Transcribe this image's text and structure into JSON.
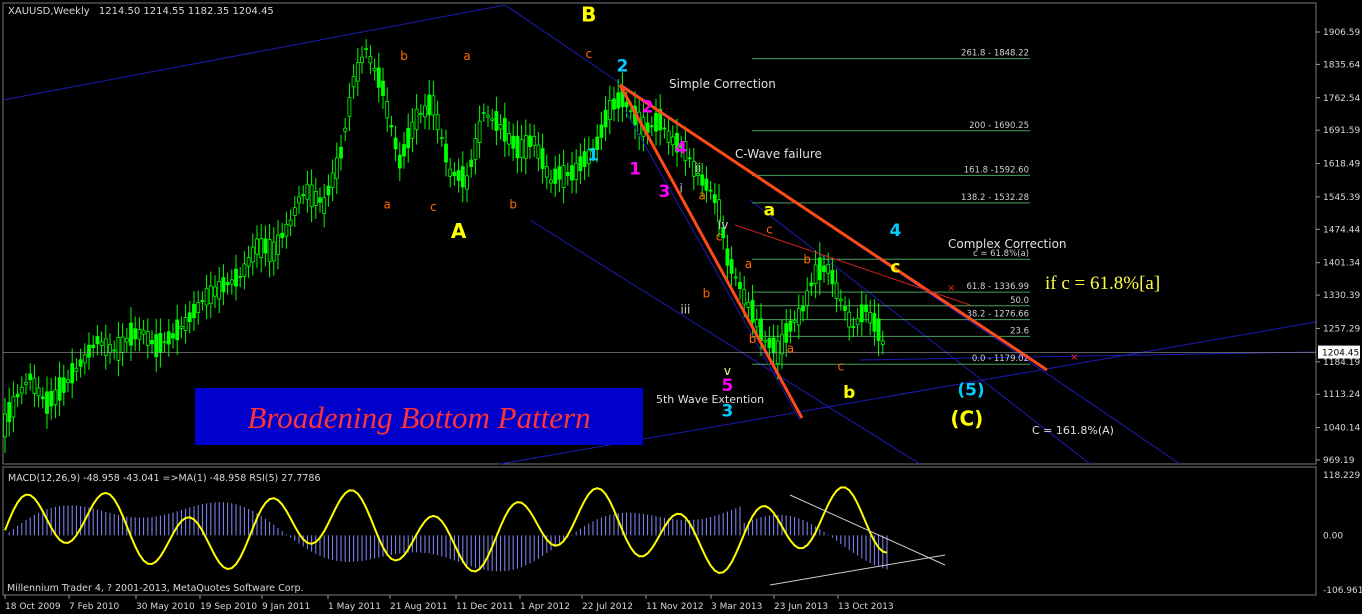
{
  "header": {
    "symbol": "XAUUSD,Weekly",
    "ohlc": "1214.50 1214.55 1182.35 1204.45"
  },
  "chart_data": {
    "type": "line",
    "price_axis": {
      "ticks": [
        1906.59,
        1835.64,
        1762.54,
        1691.59,
        1618.49,
        1545.39,
        1474.44,
        1401.34,
        1330.39,
        1257.29,
        1184.19,
        1113.24,
        1040.14,
        969.19
      ],
      "ylim": [
        969.19,
        1940
      ],
      "current_price": 1204.45
    },
    "time_axis": {
      "ticks": [
        "18 Oct 2009",
        "7 Feb 2010",
        "30 May 2010",
        "19 Sep 2010",
        "9 Jan 2011",
        "1 May 2011",
        "21 Aug 2011",
        "11 Dec 2011",
        "1 Apr 2012",
        "22 Jul 2012",
        "11 Nov 2012",
        "3 Mar 2013",
        "23 Jun 2013",
        "13 Oct 2013"
      ]
    },
    "price_series": {
      "name": "XAUUSD Weekly close (approx.)",
      "t": [
        0,
        3,
        6,
        10,
        14,
        18,
        22,
        26,
        30,
        33,
        36,
        40,
        44,
        48,
        52,
        56,
        60,
        64,
        68,
        70,
        72,
        76,
        80,
        83,
        86,
        90,
        94,
        98,
        102,
        106,
        110,
        114,
        118,
        122,
        126,
        130,
        132,
        135,
        138,
        141,
        144,
        147,
        150,
        153,
        156,
        158,
        160,
        162,
        164,
        166,
        168,
        170,
        172,
        175,
        178,
        181,
        184,
        187,
        190,
        193,
        196,
        199,
        202,
        205,
        208,
        210
      ],
      "close": [
        1050,
        1110,
        1150,
        1090,
        1130,
        1180,
        1230,
        1210,
        1240,
        1250,
        1215,
        1240,
        1280,
        1330,
        1350,
        1370,
        1440,
        1430,
        1490,
        1540,
        1560,
        1530,
        1640,
        1800,
        1870,
        1780,
        1620,
        1720,
        1750,
        1600,
        1580,
        1730,
        1700,
        1650,
        1670,
        1580,
        1595,
        1595,
        1625,
        1660,
        1740,
        1760,
        1720,
        1695,
        1710,
        1680,
        1660,
        1650,
        1610,
        1580,
        1560,
        1520,
        1410,
        1350,
        1290,
        1230,
        1210,
        1260,
        1300,
        1380,
        1390,
        1320,
        1260,
        1300,
        1250,
        1204
      ]
    },
    "fibonacci": [
      {
        "label": "261.8 - 1848.22",
        "price": 1848.22
      },
      {
        "label": "200 - 1690.25",
        "price": 1690.25
      },
      {
        "label": "161.8 -1592.60",
        "price": 1592.6
      },
      {
        "label": "138.2 - 1532.28",
        "price": 1532.28
      },
      {
        "label": "c = 61.8%(a)",
        "price": 1409
      },
      {
        "label": "61.8 - 1336.99",
        "price": 1336.99
      },
      {
        "label": "50.0",
        "price": 1307
      },
      {
        "label": "38.2 - 1276.66",
        "price": 1276.66
      },
      {
        "label": "23.6",
        "price": 1240
      },
      {
        "label": "0.0 - 1179.02",
        "price": 1179.02
      }
    ],
    "wave_labels": [
      {
        "text": "B",
        "color": "#ffff00",
        "t": 139,
        "price": 1930
      },
      {
        "text": "A",
        "color": "#ffff00",
        "t": 108,
        "price": 1455
      },
      {
        "text": "c",
        "color": "#ff6a00",
        "t": 139,
        "price": 1850
      },
      {
        "text": "b",
        "color": "#ff6a00",
        "t": 95,
        "price": 1845
      },
      {
        "text": "a",
        "color": "#ff6a00",
        "t": 110,
        "price": 1845
      },
      {
        "text": "a",
        "color": "#ff6a00",
        "t": 91,
        "price": 1520
      },
      {
        "text": "c",
        "color": "#ff6a00",
        "t": 102,
        "price": 1515
      },
      {
        "text": "b",
        "color": "#ff6a00",
        "t": 121,
        "price": 1520
      },
      {
        "text": "2",
        "color": "#00ccff",
        "t": 147,
        "price": 1820
      },
      {
        "text": "1",
        "color": "#00ccff",
        "t": 140,
        "price": 1625
      },
      {
        "text": "2",
        "color": "#ff00ff",
        "t": 153,
        "price": 1730
      },
      {
        "text": "1",
        "color": "#ff00ff",
        "t": 150,
        "price": 1595
      },
      {
        "text": "3",
        "color": "#ff00ff",
        "t": 157,
        "price": 1545
      },
      {
        "text": "4",
        "color": "#ff00ff",
        "t": 161,
        "price": 1640
      },
      {
        "text": "ii",
        "color": "#cccccc",
        "t": 165,
        "price": 1600
      },
      {
        "text": "i",
        "color": "#cccccc",
        "t": 161,
        "price": 1555
      },
      {
        "text": "a",
        "color": "#ff6a00",
        "t": 166,
        "price": 1540
      },
      {
        "text": "iv",
        "color": "#cccccc",
        "t": 171,
        "price": 1475
      },
      {
        "text": "c",
        "color": "#ff6a00",
        "t": 170,
        "price": 1450
      },
      {
        "text": "b",
        "color": "#ff6a00",
        "t": 167,
        "price": 1325
      },
      {
        "text": "iii",
        "color": "#cccccc",
        "t": 162,
        "price": 1290
      },
      {
        "text": "a",
        "color": "#ff6a00",
        "t": 177,
        "price": 1390
      },
      {
        "text": "b",
        "color": "#ff6a00",
        "t": 178,
        "price": 1225
      },
      {
        "text": "c",
        "color": "#ff6a00",
        "t": 182,
        "price": 1465
      },
      {
        "text": "b",
        "color": "#ff6a00",
        "t": 191,
        "price": 1400
      },
      {
        "text": "a",
        "color": "#ff6a00",
        "t": 187,
        "price": 1205
      },
      {
        "text": "c",
        "color": "#ff6a00",
        "t": 199,
        "price": 1165
      },
      {
        "text": "v",
        "color": "#ffff88",
        "t": 172,
        "price": 1155
      },
      {
        "text": "5",
        "color": "#ff00ff",
        "t": 172,
        "price": 1120
      },
      {
        "text": "3",
        "color": "#00ccff",
        "t": 172,
        "price": 1065
      },
      {
        "text": "a",
        "color": "#ffff00",
        "t": 182,
        "price": 1505
      },
      {
        "text": "4",
        "color": "#00ccff",
        "t": 212,
        "price": 1460
      },
      {
        "text": "c",
        "color": "#ffff00",
        "t": 212,
        "price": 1380
      },
      {
        "text": "b",
        "color": "#ffff00",
        "t": 201,
        "price": 1105
      },
      {
        "text": "(5)",
        "color": "#00ccff",
        "t": 230,
        "price": 1110
      },
      {
        "text": "(C)",
        "color": "#ffff00",
        "t": 229,
        "price": 1045
      }
    ],
    "annotations": {
      "simple_correction": "Simple Correction",
      "c_wave_failure": "C-Wave failure",
      "complex_correction": "Complex Correction",
      "if_c": "if c = 61.8%[a]",
      "fifth_wave": "5th Wave Extention",
      "c_161": "C = 161.8%(A)",
      "pattern_title": "Broadening Bottom Pattern"
    },
    "indicator": {
      "header": "MACD(12,26,9) -48.958 -43.041 =>MA(1) -48.958 RSI(5) 27.7786",
      "ticks": [
        118.229,
        0.0,
        -106.961
      ],
      "ylim": [
        -106.961,
        118.229
      ]
    },
    "footer": "Millennium Trader 4, ? 2001-2013, MetaQuotes Software Corp."
  },
  "colors": {
    "background": "#000000",
    "candle": "#00ff00",
    "fib_line": "#4aa05a",
    "trend_orange": "#ff4a1a",
    "channel_blue": "#1b1bb4",
    "rsi": "#ffff00",
    "macd_hist": "#8888ff",
    "title_box": "#0000cc",
    "title_text": "#ff3333"
  }
}
